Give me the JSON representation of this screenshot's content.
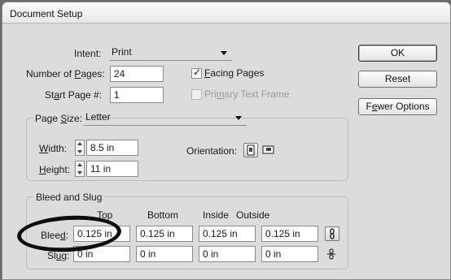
{
  "window": {
    "title": "Document Setup"
  },
  "intent": {
    "label_text": "Intent:",
    "value": "Print"
  },
  "pages": {
    "label_prefix": "Number of ",
    "label_u": "P",
    "label_suffix": "ages:",
    "value": "24"
  },
  "start_page": {
    "label_prefix": "St",
    "label_u": "a",
    "label_suffix": "rt Page #:",
    "value": "1"
  },
  "facing_pages": {
    "label_u": "F",
    "label_rest": "acing Pages",
    "checked": true
  },
  "primary_text_frame": {
    "label_pre": "Pri",
    "label_u": "m",
    "label_post": "ary Text Frame",
    "enabled": false
  },
  "page_size": {
    "label_pre": "Page ",
    "label_u": "S",
    "label_post": "ize:",
    "value": "Letter"
  },
  "width": {
    "label_u": "W",
    "label_rest": "idth:",
    "value": "8.5 in"
  },
  "height": {
    "label_u": "H",
    "label_rest": "eight:",
    "value": "11 in"
  },
  "orientation": {
    "label": "Orientation:"
  },
  "bleed_slug": {
    "title": "Bleed and Slug",
    "columns": [
      "Top",
      "Bottom",
      "Inside",
      "Outside"
    ],
    "bleed": {
      "label_pre": "Blee",
      "label_u": "d",
      "label_post": ":",
      "values": [
        "0.125 in",
        "0.125 in",
        "0.125 in",
        "0.125 in"
      ]
    },
    "slug": {
      "label_pre": "Sl",
      "label_u": "u",
      "label_post": "g:",
      "values": [
        "0 in",
        "0 in",
        "0 in",
        "0 in"
      ]
    }
  },
  "buttons": {
    "ok": "OK",
    "reset": "Reset",
    "fewer_u": "e",
    "fewer_pre": "F",
    "fewer_post": "wer Options"
  }
}
